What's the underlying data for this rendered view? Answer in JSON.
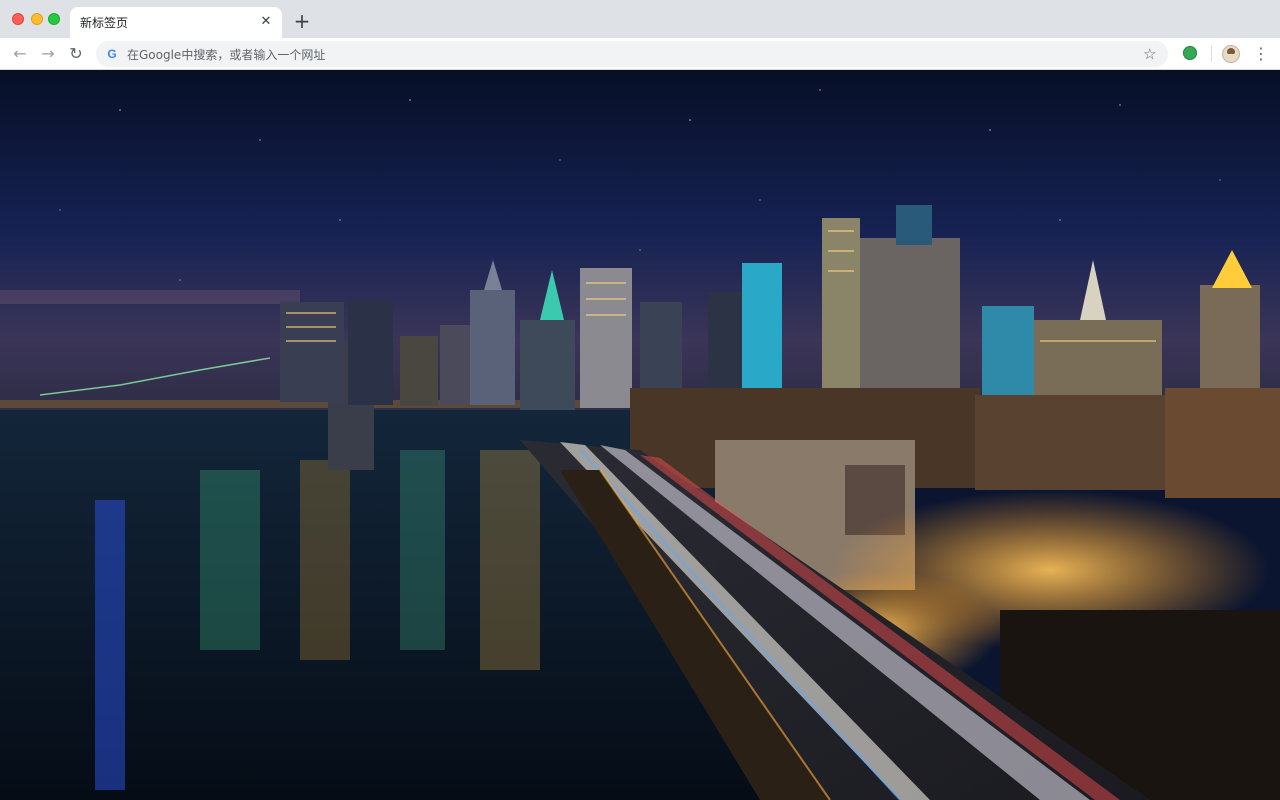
{
  "window": {
    "controls": [
      "close",
      "minimize",
      "maximize"
    ]
  },
  "tab": {
    "title": "新标签页",
    "close_symbol": "✕"
  },
  "newtab": {
    "symbol": "+"
  },
  "toolbar": {
    "back_symbol": "←",
    "forward_symbol": "→",
    "reload_symbol": "↻",
    "omnibox_placeholder": "在Google中搜索，或者输入一个网址",
    "star_symbol": "☆",
    "menu_symbol": "⋮",
    "icons": [
      "google-g-icon",
      "bookmark-star-icon",
      "extension-icon",
      "profile-avatar-icon",
      "menu-icon"
    ]
  },
  "wallpaper": {
    "subject": "night city skyline with river and light-trail highway",
    "colors": {
      "sky_top": "#08112a",
      "sky_bottom": "#1a2550",
      "water": "#06121e",
      "glow": "#ffb13b"
    }
  }
}
